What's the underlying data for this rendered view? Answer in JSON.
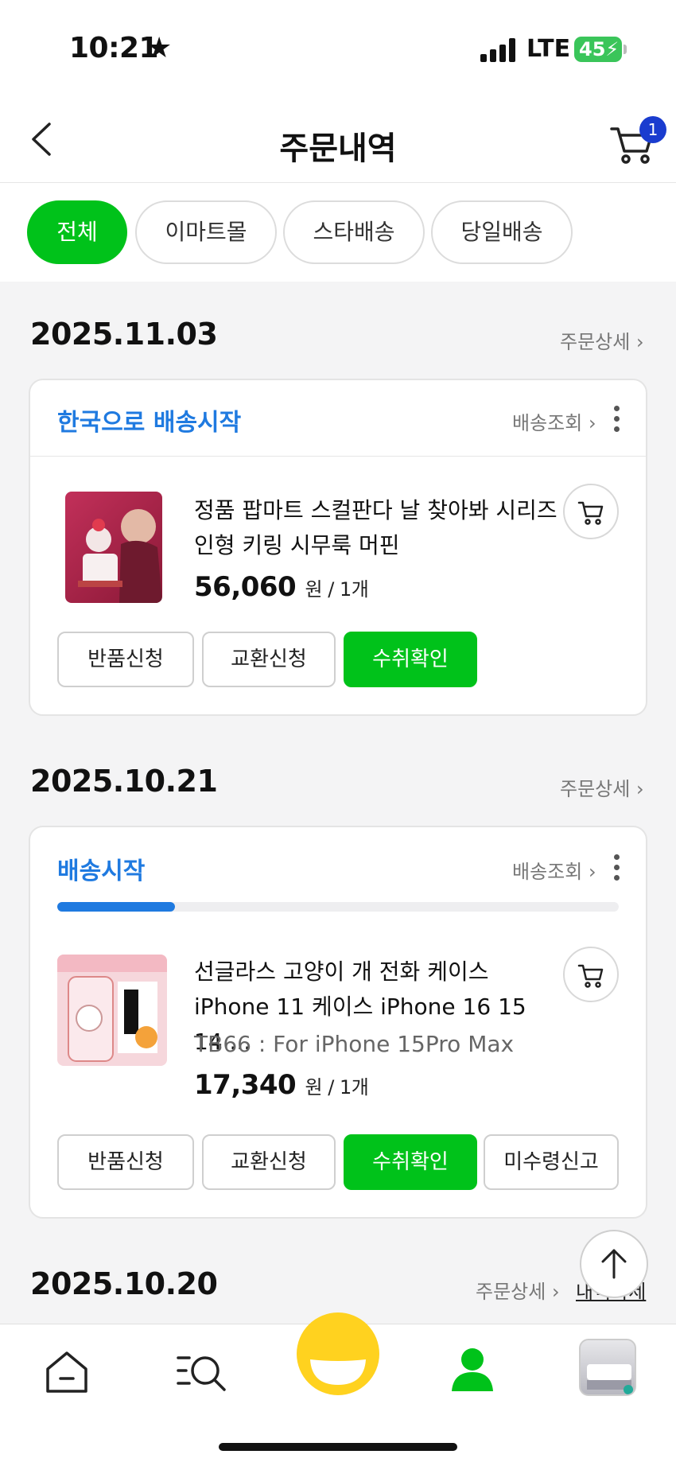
{
  "status_bar": {
    "time": "10:21",
    "network": "LTE",
    "battery": "45"
  },
  "header": {
    "title": "주문내역",
    "cart_count": "1"
  },
  "filters": [
    "전체",
    "이마트몰",
    "스타배송",
    "당일배송"
  ],
  "orders": [
    {
      "date": "2025.11.03",
      "detail_link": "주문상세 ›",
      "status": "한국으로 배송시작",
      "track_link": "배송조회 ›",
      "product_name": "정품 팝마트 스컬판다 날 찾아봐 시리즈 인형 키링 시무룩 머핀",
      "price": "56,060",
      "unit": "원 / 1개",
      "buttons": [
        "반품신청",
        "교환신청",
        "수취확인"
      ]
    },
    {
      "date": "2025.10.21",
      "detail_link": "주문상세 ›",
      "status": "배송시작",
      "track_link": "배송조회 ›",
      "progress": 0.21,
      "product_name": "선글라스 고양이 개 전화 케이스 iPhone 11 케이스 iPhone 16 15 14 ...",
      "option": "TB66 : For iPhone 15Pro Max",
      "price": "17,340",
      "unit": "원 / 1개",
      "buttons": [
        "반품신청",
        "교환신청",
        "수취확인",
        "미수령신고"
      ]
    },
    {
      "date": "2025.10.20",
      "detail_link": "주문상세 ›",
      "delete_link": "내역삭제"
    }
  ],
  "colors": {
    "brand_green": "#00c21a",
    "status_blue": "#1f7ae0"
  },
  "icons": [
    "back-icon",
    "cart-icon",
    "more-icon",
    "home-icon",
    "search-icon",
    "emoji-icon",
    "profile-icon",
    "scroll-top-icon"
  ]
}
